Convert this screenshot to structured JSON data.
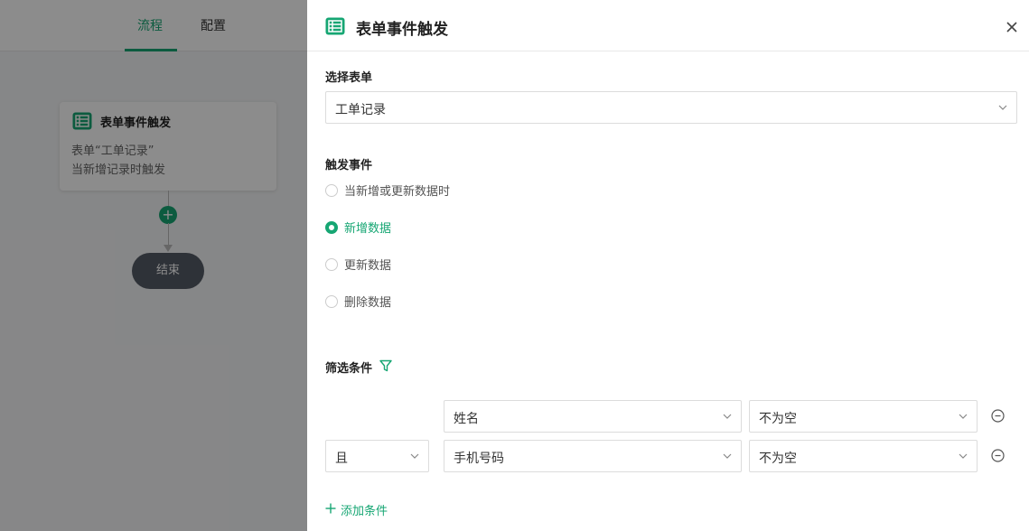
{
  "canvas": {
    "tabs": [
      {
        "label": "流程",
        "active": true
      },
      {
        "label": "配置",
        "active": false
      }
    ],
    "node": {
      "title": "表单事件触发",
      "line1": "表单“工单记录”",
      "line2": "当新增记录时触发"
    },
    "end_label": "结束"
  },
  "drawer": {
    "title": "表单事件触发",
    "form_section": {
      "label": "选择表单",
      "selected": "工单记录"
    },
    "event_section": {
      "label": "触发事件",
      "options": [
        {
          "label": "当新增或更新数据时",
          "selected": false
        },
        {
          "label": "新增数据",
          "selected": true
        },
        {
          "label": "更新数据",
          "selected": false
        },
        {
          "label": "删除数据",
          "selected": false
        }
      ]
    },
    "filter_section": {
      "label": "筛选条件",
      "logic": "且",
      "conditions": [
        {
          "field": "姓名",
          "operator": "不为空"
        },
        {
          "field": "手机号码",
          "operator": "不为空"
        }
      ],
      "add_label": "添加条件"
    }
  },
  "colors": {
    "accent": "#16a673",
    "overlay": "rgba(0,0,0,0.45)"
  },
  "icons": [
    "table-icon",
    "close-icon",
    "chevron-down-icon",
    "filter-icon",
    "minus-circle-icon",
    "plus-icon"
  ]
}
